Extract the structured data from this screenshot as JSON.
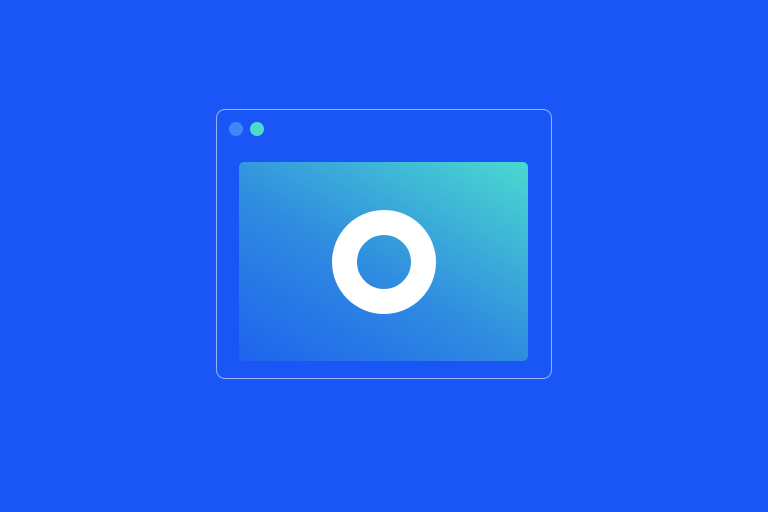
{
  "colors": {
    "background": "#1A56F5",
    "window_border": "#FFFFFF",
    "dot_blue": "#3F86F6",
    "dot_teal": "#4FD9CC",
    "content_gradient_start": "#1E63EE",
    "content_gradient_mid": "#2F8BE0",
    "content_gradient_end": "#4BD9CF",
    "ring": "#FFFFFF"
  },
  "window": {
    "controls": [
      {
        "icon": "window-control-dot-icon",
        "color": "#3F86F6"
      },
      {
        "icon": "window-control-dot-icon",
        "color": "#4FD9CC"
      }
    ]
  },
  "content": {
    "icon": "ring-circle-icon"
  }
}
